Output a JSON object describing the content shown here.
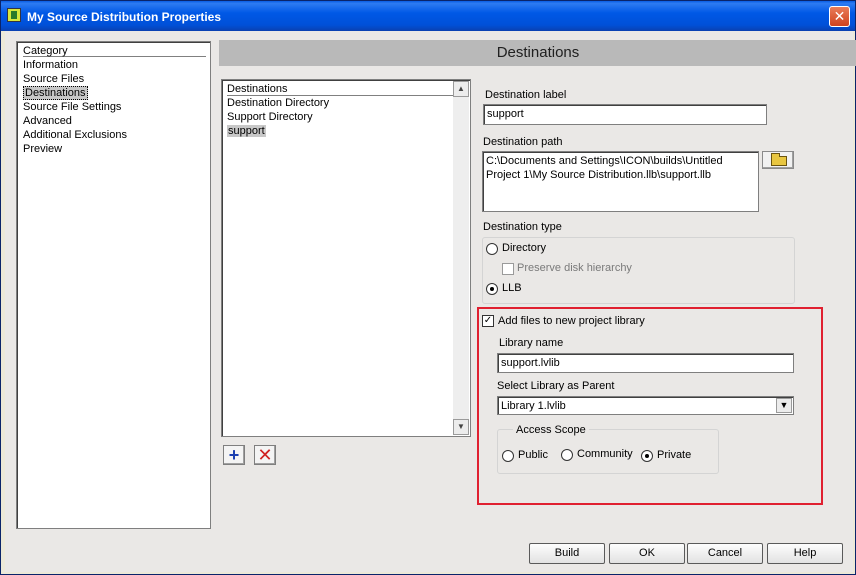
{
  "window": {
    "title": "My Source Distribution Properties",
    "close_glyph": "✕"
  },
  "category": {
    "header": "Category",
    "items": [
      {
        "label": "Information"
      },
      {
        "label": "Source Files"
      },
      {
        "label": "Destinations",
        "selected": true
      },
      {
        "label": "Source File Settings"
      },
      {
        "label": "Advanced"
      },
      {
        "label": "Additional Exclusions"
      },
      {
        "label": "Preview"
      }
    ]
  },
  "section_title": "Destinations",
  "destinations_list": {
    "header": "Destinations",
    "items": [
      {
        "label": "Destination Directory"
      },
      {
        "label": "Support Directory"
      },
      {
        "label": "support",
        "selected": true
      }
    ]
  },
  "list_buttons": {
    "add_glyph": "+",
    "remove_glyph": "✕"
  },
  "form": {
    "destination_label": {
      "label": "Destination label",
      "value": "support"
    },
    "destination_path": {
      "label": "Destination path",
      "value": "C:\\Documents and Settings\\ICON\\builds\\Untitled Project 1\\My Source Distribution.llb\\support.llb"
    },
    "destination_type": {
      "label": "Destination type",
      "directory_label": "Directory",
      "preserve_label": "Preserve disk hierarchy",
      "llb_label": "LLB",
      "selected": "LLB"
    },
    "add_files": {
      "label": "Add files to new project library",
      "checked": true
    },
    "library_name": {
      "label": "Library name",
      "value": "support.lvlib"
    },
    "library_parent": {
      "label": "Select Library as Parent",
      "value": "Library 1.lvlib"
    },
    "access_scope": {
      "label": "Access Scope",
      "public_label": "Public",
      "community_label": "Community",
      "private_label": "Private",
      "selected": "Private"
    }
  },
  "buttons": {
    "build": "Build",
    "ok": "OK",
    "cancel": "Cancel",
    "help": "Help"
  },
  "colors": {
    "highlight_border": "#e02030",
    "titlebar": "#0058e6",
    "header_bar": "#b9b9b9"
  }
}
